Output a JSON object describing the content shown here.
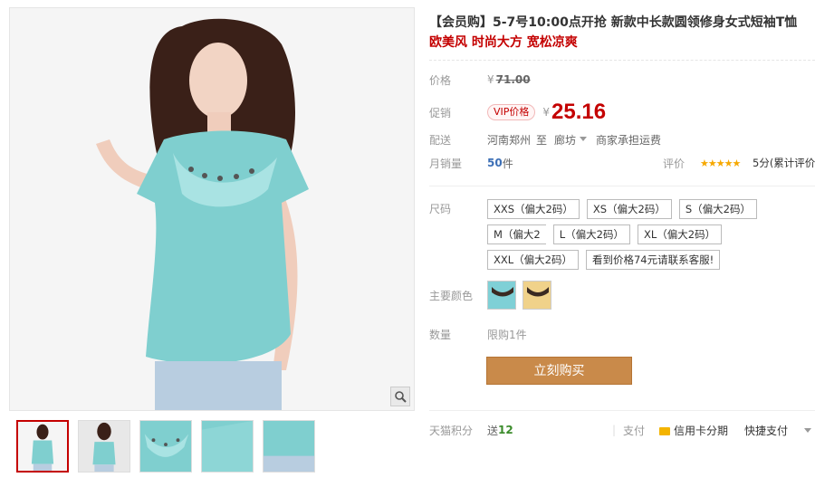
{
  "product": {
    "title": "【会员购】5-7号10:00点开抢 新款中长款圆领修身女式短袖T恤",
    "subtitle": "欧美风 时尚大方 宽松凉爽"
  },
  "price": {
    "label": "价格",
    "currency": "¥",
    "original": "71.00"
  },
  "promo": {
    "label": "促销",
    "tag": "VIP价格",
    "currency": "¥",
    "value": "25.16"
  },
  "delivery": {
    "label": "配送",
    "from": "河南郑州",
    "to_word": "至",
    "to": "廊坊",
    "fee_note": "商家承担运费"
  },
  "sales": {
    "label": "月销量",
    "count": "50",
    "unit": "件",
    "rating_label": "评价",
    "stars": "★★★★★",
    "rating_text": "5分(累计评价"
  },
  "size": {
    "label": "尺码",
    "options": [
      "XXS（偏大2码）",
      "XS（偏大2码）",
      "S（偏大2码）",
      "M（偏大2",
      "L（偏大2码）",
      "XL（偏大2码）",
      "XXL（偏大2码）",
      "看到价格74元请联系客服!"
    ]
  },
  "color": {
    "label": "主要颜色",
    "colors": [
      "#7fd0d6",
      "#f0d28a"
    ]
  },
  "quantity": {
    "label": "数量",
    "limit": "限购1件"
  },
  "buy_button": "立刻购买",
  "points": {
    "label": "天猫积分",
    "give": "送",
    "amount": "12",
    "pay_label": "支付",
    "credit": "信用卡分期",
    "quick_pay": "快捷支付"
  }
}
